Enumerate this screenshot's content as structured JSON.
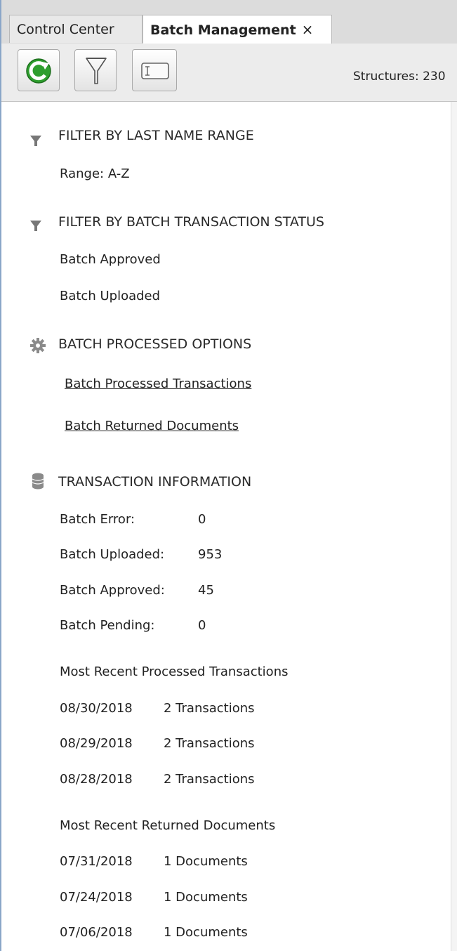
{
  "tabs": {
    "control_center": "Control Center",
    "batch_management": "Batch Management",
    "close_glyph": "×"
  },
  "toolbar": {
    "refresh_icon": "refresh-icon",
    "filter_icon": "funnel-icon",
    "display_icon": "monitor-icon",
    "structures_text": "Structures: 230"
  },
  "colors": {
    "refresh_green": "#2e9e2e",
    "accent_blue": "#8aa6c8"
  },
  "sections": {
    "last_name": {
      "icon": "funnel-icon",
      "title": "FILTER BY LAST NAME RANGE",
      "range": "Range: A-Z"
    },
    "status": {
      "icon": "funnel-icon",
      "title": "FILTER BY BATCH TRANSACTION STATUS",
      "items": [
        "Batch Approved",
        "Batch Uploaded"
      ]
    },
    "processed_options": {
      "icon": "gear-icon",
      "title": "BATCH PROCESSED OPTIONS",
      "links": [
        "Batch Processed Transactions",
        "Batch Returned Documents"
      ]
    },
    "transaction_info": {
      "icon": "database-icon",
      "title": "TRANSACTION INFORMATION",
      "stats": [
        {
          "label": "Batch Error:",
          "value": "0"
        },
        {
          "label": "Batch Uploaded:",
          "value": "953"
        },
        {
          "label": "Batch Approved:",
          "value": "45"
        },
        {
          "label": "Batch Pending:",
          "value": "0"
        }
      ],
      "recent_processed_title": "Most Recent Processed Transactions",
      "recent_processed": [
        {
          "date": "08/30/2018",
          "count": "2 Transactions"
        },
        {
          "date": "08/29/2018",
          "count": "2 Transactions"
        },
        {
          "date": "08/28/2018",
          "count": "2 Transactions"
        }
      ],
      "recent_returned_title": "Most Recent Returned Documents",
      "recent_returned": [
        {
          "date": "07/31/2018",
          "count": "1 Documents"
        },
        {
          "date": "07/24/2018",
          "count": "1 Documents"
        },
        {
          "date": "07/06/2018",
          "count": "1 Documents"
        }
      ]
    }
  }
}
